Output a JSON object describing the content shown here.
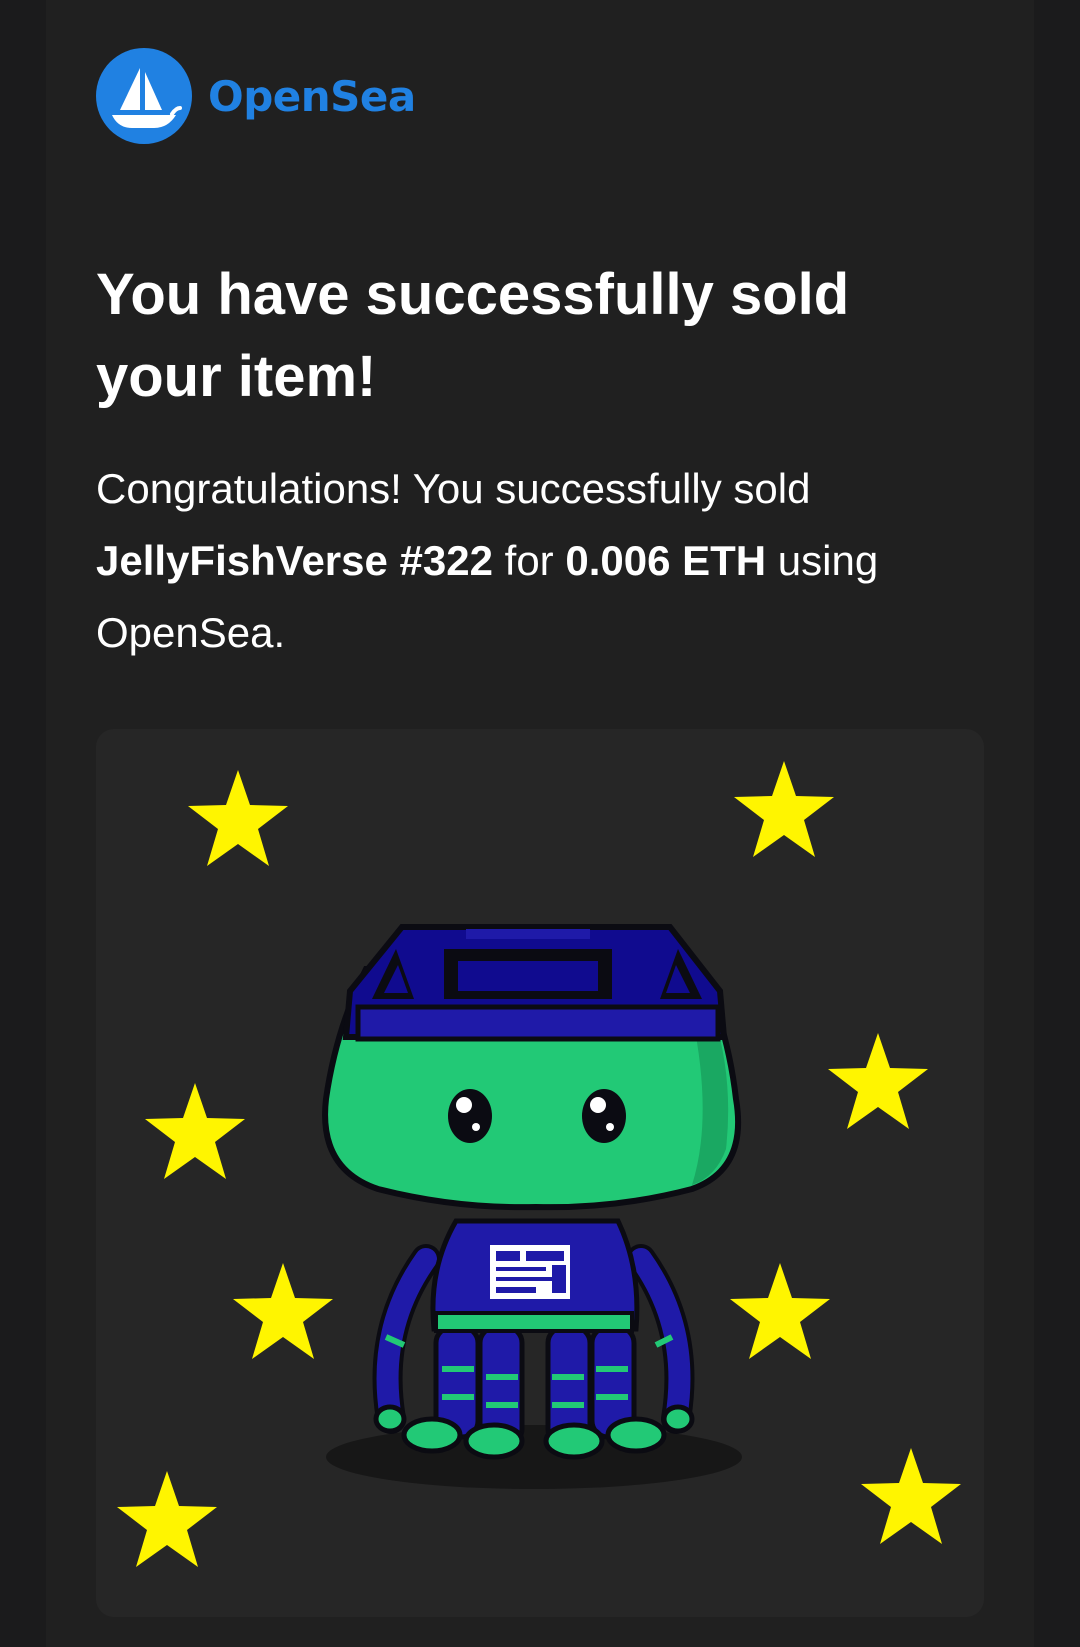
{
  "brand": {
    "name": "OpenSea",
    "color": "#2081e2",
    "icon": "opensea-ship-icon"
  },
  "email": {
    "headline": "You have successfully sold your item!",
    "message": {
      "intro": "Congratulations! You successfully sold",
      "item_name": "JellyFishVerse #322",
      "connector": "for",
      "price": "0.006 ETH",
      "outro": "using OpenSea."
    }
  },
  "nft_image": {
    "subject": "jellyfish-character-illustration",
    "background": "#262626",
    "star_color": "#fff500",
    "body_color": "#22c976",
    "hat_color": "#100b8f"
  }
}
